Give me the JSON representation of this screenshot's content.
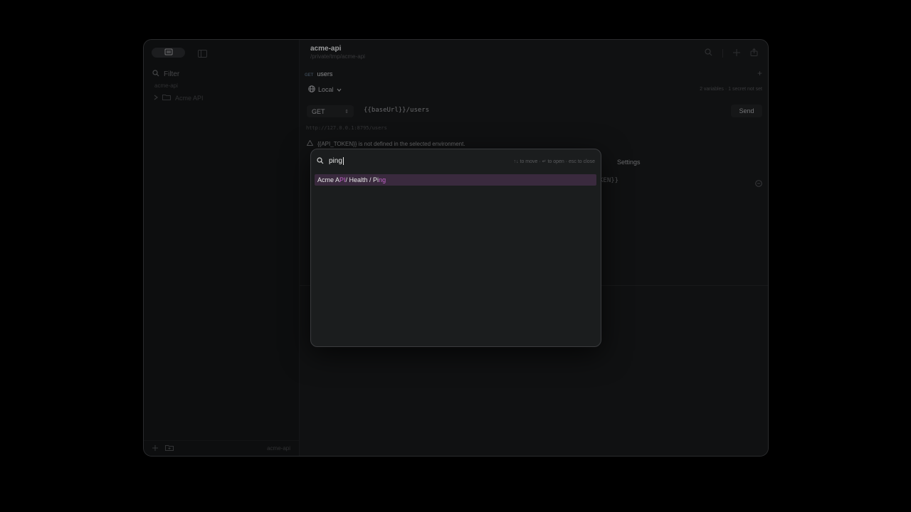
{
  "sidebar": {
    "filter_placeholder": "Filter",
    "workspace_label": "acme-api",
    "tree": [
      {
        "label": "Acme API",
        "type": "folder"
      }
    ],
    "footer_workspace": "acme-api"
  },
  "header": {
    "title": "acme-api",
    "path": "/private/tmp/acme-api"
  },
  "tab": {
    "method": "GET",
    "name": "users"
  },
  "environment": {
    "name": "Local",
    "summary": "2 variables · 1 secret not set"
  },
  "request": {
    "method": "GET",
    "url": "{{baseUrl}}/users",
    "send_label": "Send",
    "resolved_url": "http://127.0.0.1:8795/users"
  },
  "warning": {
    "text": "{{API_TOKEN}} is not defined in the selected environment."
  },
  "request_tabs": {
    "settings_label": "Settings"
  },
  "background_fragments": {
    "token_tail": "KEN}}"
  },
  "palette": {
    "query": "ping",
    "hint": "↑↓ to move · ↵ to open · esc to close",
    "results": [
      {
        "segments": [
          {
            "text": "Acme A",
            "match": false
          },
          {
            "text": "PI",
            "match": true
          },
          {
            "text": " / Health / Pi",
            "match": false
          },
          {
            "text": "ng",
            "match": true
          }
        ]
      }
    ]
  },
  "colors": {
    "accent_match": "#c063c8",
    "selected_row": "#3a2a3e",
    "window_bg": "#151617"
  }
}
